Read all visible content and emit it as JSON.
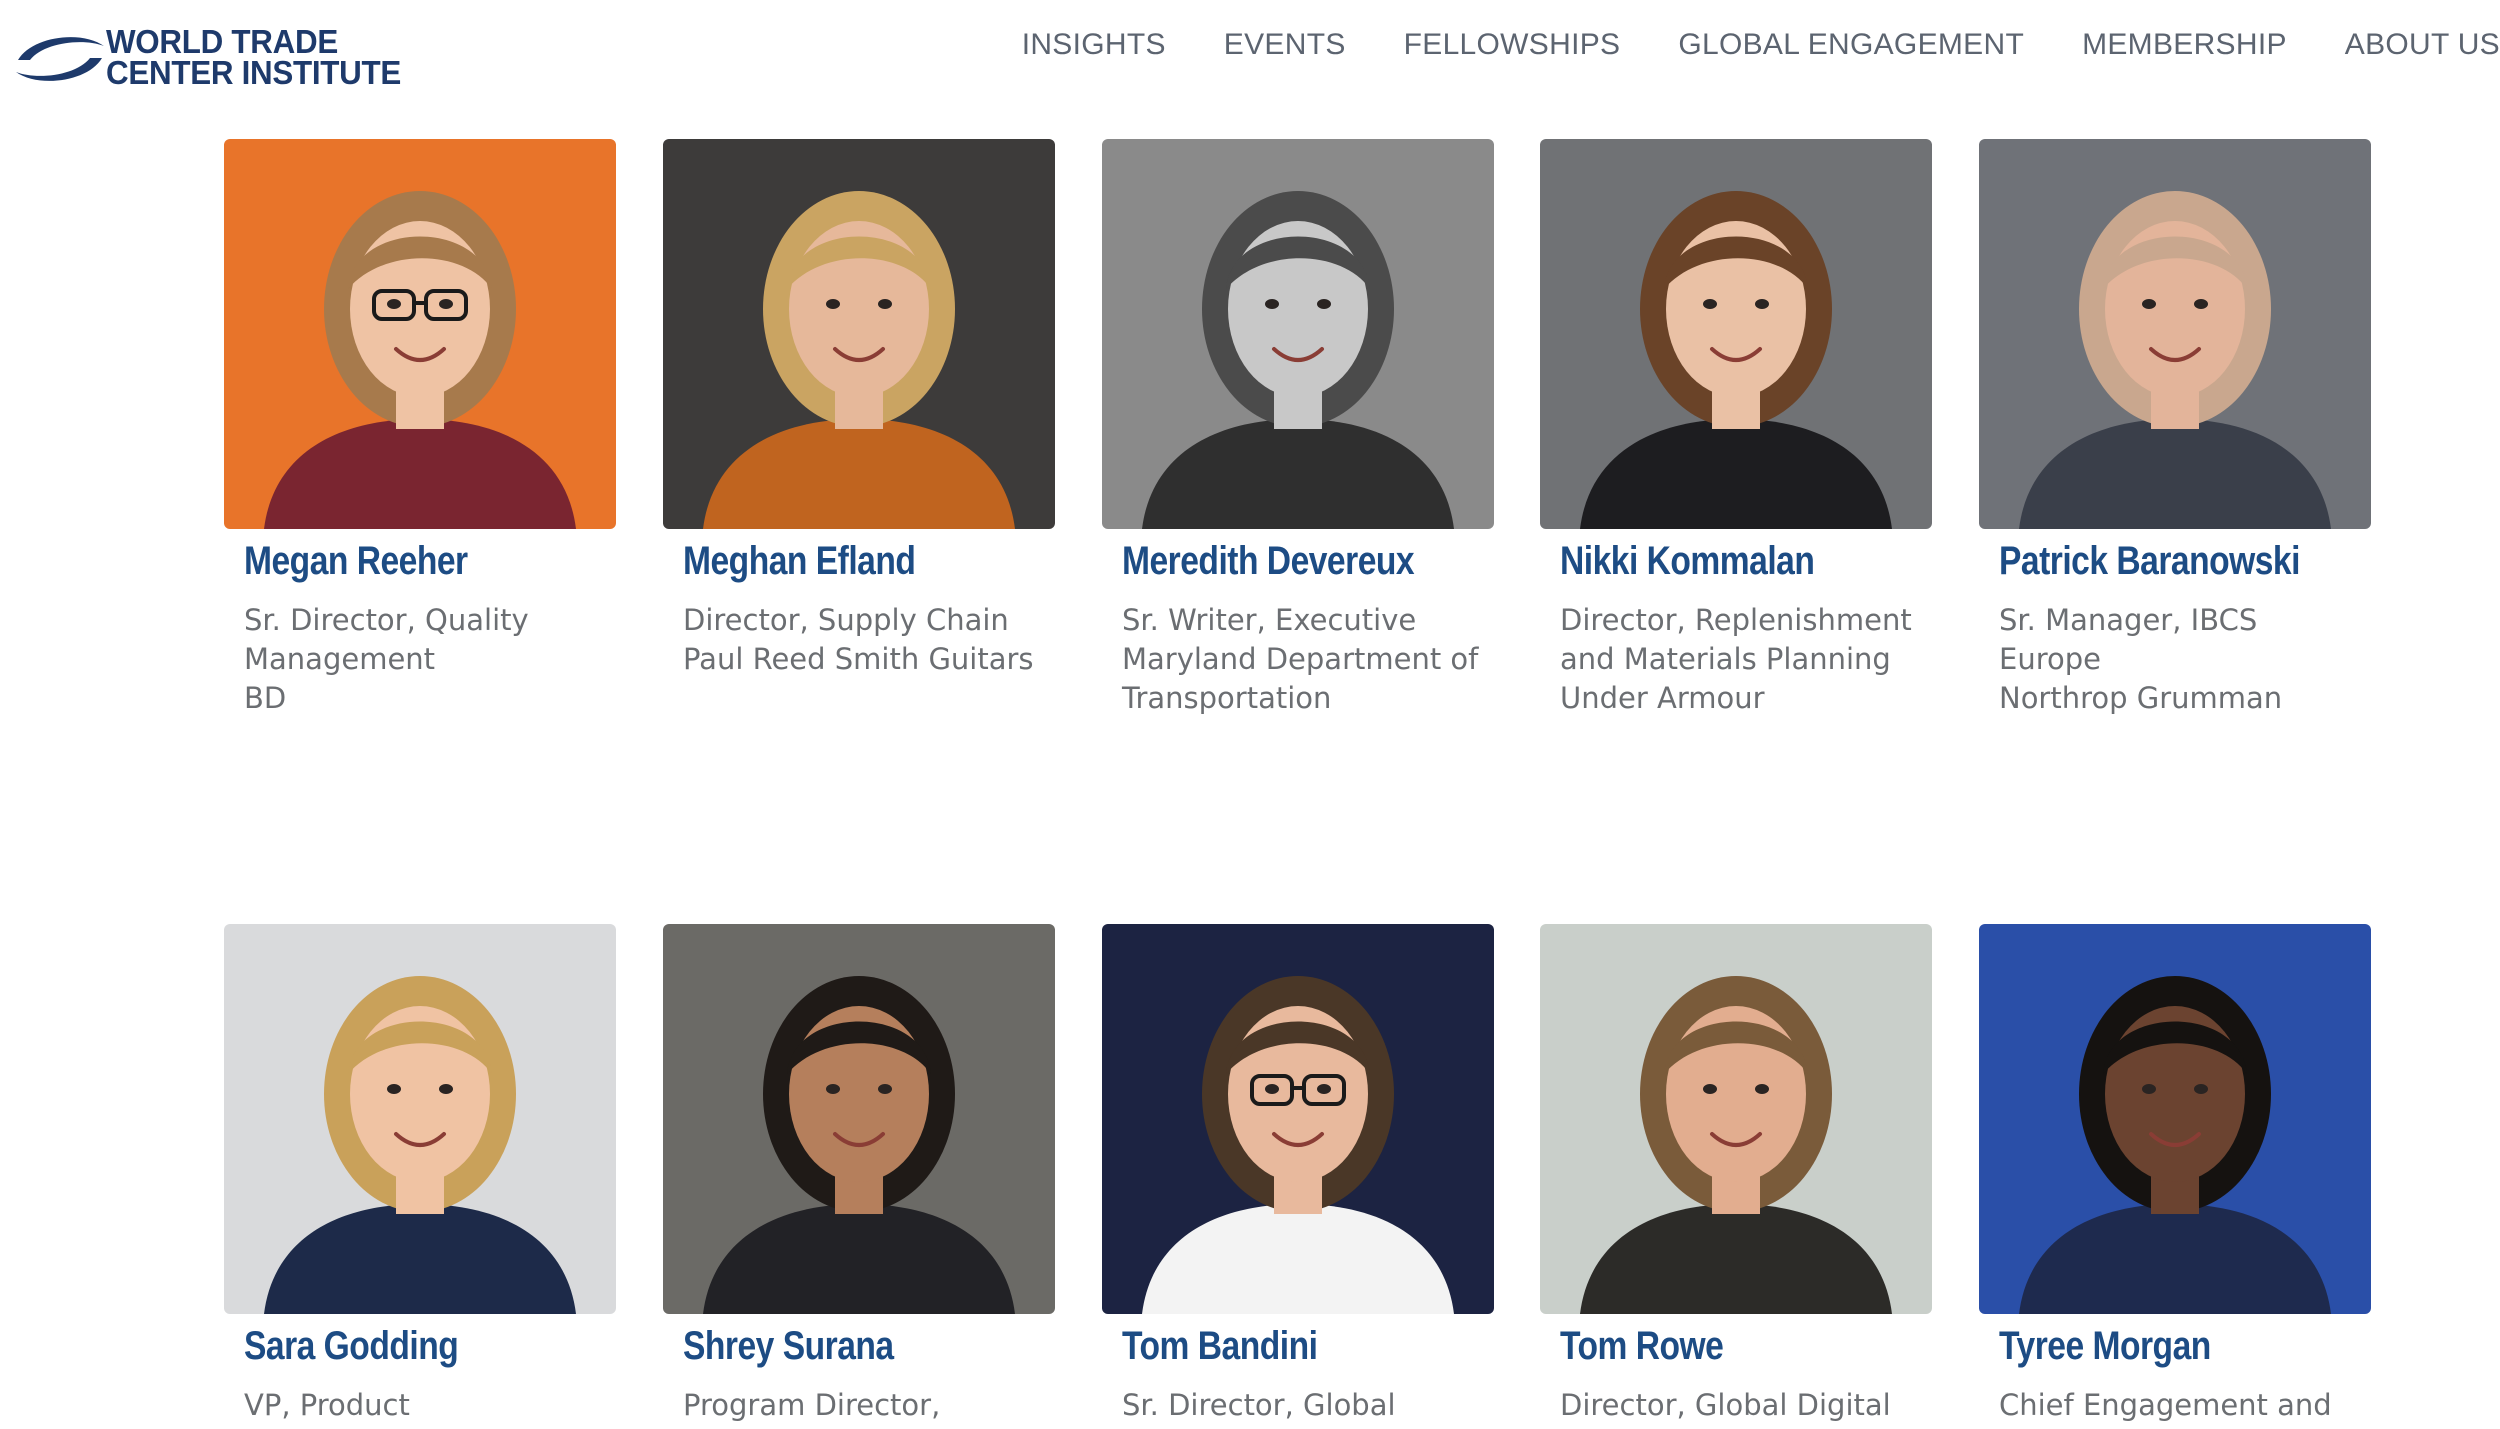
{
  "brand": {
    "line1": "WORLD TRADE",
    "line2": "CENTER INSTITUTE",
    "primary_color": "#1e3a6b",
    "accent_color": "#1d4c84"
  },
  "nav": {
    "items": [
      {
        "label": "INSIGHTS"
      },
      {
        "label": "EVENTS"
      },
      {
        "label": "FELLOWSHIPS"
      },
      {
        "label": "GLOBAL ENGAGEMENT"
      },
      {
        "label": "MEMBERSHIP"
      },
      {
        "label": "ABOUT US"
      }
    ]
  },
  "people": [
    {
      "name": "Megan Reeher",
      "lines": [
        "Sr. Director, Quality",
        "Management",
        "BD"
      ],
      "photo": {
        "bg": "#e8742a",
        "skin": "#efc3a4",
        "hair": "#a77a4c",
        "top": "#7a2530",
        "glasses": true
      }
    },
    {
      "name": "Meghan Efland",
      "lines": [
        "Director, Supply Chain",
        "Paul Reed Smith Guitars"
      ],
      "photo": {
        "bg": "#3d3b3a",
        "skin": "#e6b89a",
        "hair": "#caa462",
        "top": "#c0641f",
        "glasses": false
      }
    },
    {
      "name": "Meredith Devereux",
      "lines": [
        "Sr. Writer, Executive",
        "Maryland Department of",
        "Transportation"
      ],
      "photo": {
        "bg": "#8a8a8a",
        "skin": "#c8c8c8",
        "hair": "#4b4b4b",
        "top": "#2f2f2f",
        "glasses": false
      }
    },
    {
      "name": "Nikki Kommalan",
      "lines": [
        "Director, Replenishment",
        "and Materials Planning",
        "Under Armour"
      ],
      "photo": {
        "bg": "#707275",
        "skin": "#eac1a5",
        "hair": "#6a4328",
        "top": "#1d1d20",
        "glasses": false
      }
    },
    {
      "name": "Patrick Baranowski",
      "lines": [
        "Sr. Manager, IBCS",
        "Europe",
        "Northrop Grumman"
      ],
      "photo": {
        "bg": "#6f7278",
        "skin": "#e3b49a",
        "hair": "#c9a78e",
        "top": "#3a3f4a",
        "glasses": false
      }
    },
    {
      "name": "Sara Godding",
      "lines": [
        "VP, Product"
      ],
      "photo": {
        "bg": "#d9dadc",
        "skin": "#f0c3a3",
        "hair": "#c9a15a",
        "top": "#1d2a49",
        "glasses": false
      }
    },
    {
      "name": "Shrey Surana",
      "lines": [
        "Program Director,"
      ],
      "photo": {
        "bg": "#6b6a66",
        "skin": "#b57f5c",
        "hair": "#1f1a17",
        "top": "#222226",
        "glasses": false
      }
    },
    {
      "name": "Tom Bandini",
      "lines": [
        "Sr. Director, Global"
      ],
      "photo": {
        "bg": "#1c2342",
        "skin": "#e8b99d",
        "hair": "#4a3727",
        "top": "#f3f3f3",
        "glasses": true
      }
    },
    {
      "name": "Tom Rowe",
      "lines": [
        "Director, Global Digital"
      ],
      "photo": {
        "bg": "#c9cfca",
        "skin": "#e2ad8f",
        "hair": "#7a5b3a",
        "top": "#2c2b28",
        "glasses": false
      }
    },
    {
      "name": "Tyree Morgan",
      "lines": [
        "Chief Engagement and"
      ],
      "photo": {
        "bg": "#2a4fa8",
        "skin": "#6b4330",
        "hair": "#151210",
        "top": "#1e2a4e",
        "glasses": false
      }
    }
  ]
}
